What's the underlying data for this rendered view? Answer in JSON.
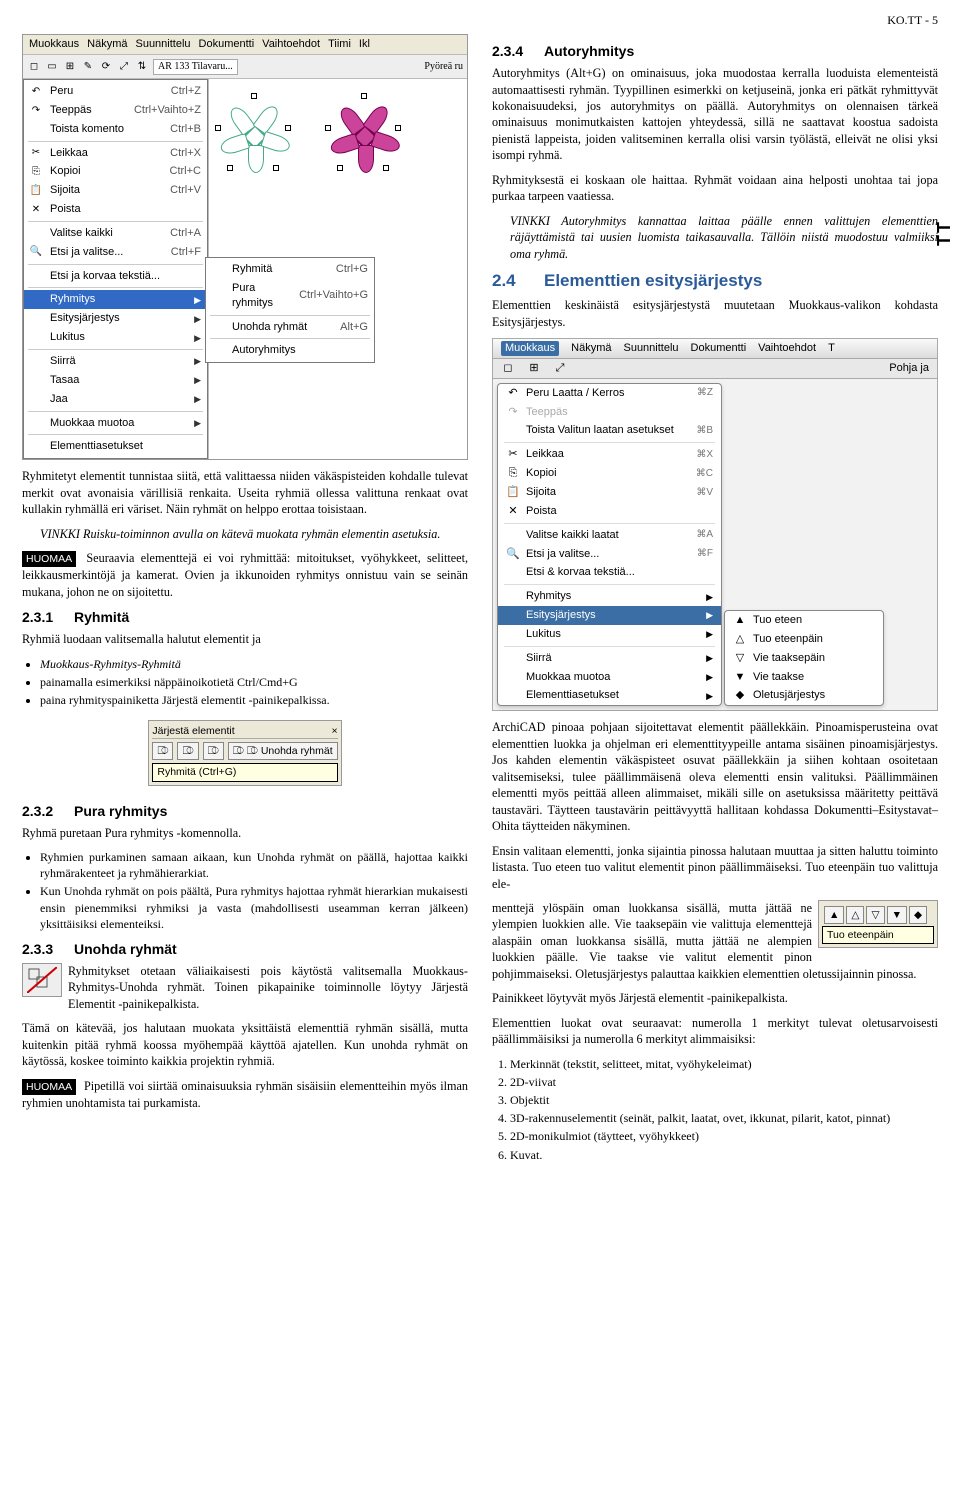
{
  "header": {
    "page_code": "KO.TT - 5"
  },
  "side_tab": "TT",
  "fig1": {
    "menubar": [
      "Muokkaus",
      "Näkymä",
      "Suunnittelu",
      "Dokumentti",
      "Vaihtoehdot",
      "Tiimi",
      "Ikl"
    ],
    "toolbar_label": "AR 133 Tilavaru...",
    "toolbar_right": "Pyöreä ru",
    "items": [
      {
        "icon": "↶",
        "label": "Peru",
        "accel": "Ctrl+Z"
      },
      {
        "icon": "↷",
        "label": "Teeppäs",
        "accel": "Ctrl+Vaihto+Z"
      },
      {
        "icon": "",
        "label": "Toista komento",
        "accel": "Ctrl+B"
      },
      {
        "sep": true
      },
      {
        "icon": "✂",
        "label": "Leikkaa",
        "accel": "Ctrl+X"
      },
      {
        "icon": "⎘",
        "label": "Kopioi",
        "accel": "Ctrl+C"
      },
      {
        "icon": "📋",
        "label": "Sijoita",
        "accel": "Ctrl+V"
      },
      {
        "icon": "✕",
        "label": "Poista",
        "accel": ""
      },
      {
        "sep": true
      },
      {
        "icon": "",
        "label": "Valitse kaikki",
        "accel": "Ctrl+A"
      },
      {
        "icon": "🔍",
        "label": "Etsi ja valitse...",
        "accel": "Ctrl+F"
      },
      {
        "sep": true
      },
      {
        "icon": "",
        "label": "Etsi ja korvaa tekstiä...",
        "accel": ""
      },
      {
        "sep": true
      },
      {
        "icon": "",
        "label": "Ryhmitys",
        "accel": "",
        "arrow": true,
        "highlight": true
      },
      {
        "icon": "",
        "label": "Esitysjärjestys",
        "accel": "",
        "arrow": true
      },
      {
        "icon": "",
        "label": "Lukitus",
        "accel": "",
        "arrow": true
      },
      {
        "sep": true
      },
      {
        "icon": "",
        "label": "Siirrä",
        "accel": "",
        "arrow": true
      },
      {
        "icon": "",
        "label": "Tasaa",
        "accel": "",
        "arrow": true
      },
      {
        "icon": "",
        "label": "Jaa",
        "accel": "",
        "arrow": true
      },
      {
        "sep": true
      },
      {
        "icon": "",
        "label": "Muokkaa muotoa",
        "accel": "",
        "arrow": true
      },
      {
        "sep": true
      },
      {
        "icon": "",
        "label": "Elementtiasetukset",
        "accel": ""
      }
    ],
    "submenu": [
      {
        "icon": "",
        "label": "Ryhmitä",
        "accel": "Ctrl+G"
      },
      {
        "icon": "",
        "label": "Pura ryhmitys",
        "accel": "Ctrl+Vaihto+G"
      },
      {
        "sep": true
      },
      {
        "icon": "",
        "label": "Unohda ryhmät",
        "accel": "Alt+G"
      },
      {
        "sep": true
      },
      {
        "icon": "",
        "label": "Autoryhmitys",
        "accel": ""
      }
    ]
  },
  "left": {
    "para1": "Ryhmitetyt elementit tunnistaa siitä, että valittaessa niiden väkäspisteiden kohdalle tulevat merkit ovat avonaisia värillisiä renkaita. Useita ryhmiä ollessa valittuna renkaat ovat kullakin ryhmällä eri väriset. Näin ryhmät on helppo erottaa toisistaan.",
    "tip1": "VINKKI Ruisku-toiminnon avulla on kätevä muokata ryhmän elementin asetuksia.",
    "huomaa1": "Seuraavia elementtejä ei voi ryhmittää: mitoitukset, vyöhykkeet, selitteet, leikkausmerkintöjä ja kamerat. Ovien ja ikkunoiden ryhmitys onnistuu vain se seinän mukana, johon ne on sijoitettu.",
    "s231_title": "Ryhmitä",
    "s231_num": "2.3.1",
    "s231_body": "Ryhmiä luodaan valitsemalla halutut elementit ja",
    "s231_list": [
      "Muokkaus-Ryhmitys-Ryhmitä",
      "painamalla esimerkiksi näppäinoikotietä Ctrl/Cmd+G",
      "paina ryhmityspainiketta Järjestä elementit -painikepalkissa."
    ],
    "fig_small": {
      "title": "Järjestä elementit",
      "btns": [
        "⎄",
        "⎄",
        "⎄",
        "⎄ Unohda ryhmät"
      ],
      "tooltip": "Ryhmitä (Ctrl+G)"
    },
    "s232_title": "Pura ryhmitys",
    "s232_num": "2.3.2",
    "s232_body": "Ryhmä puretaan Pura ryhmitys -komennolla.",
    "s232_list": [
      "Ryhmien purkaminen samaan aikaan, kun Unohda ryhmät on päällä, hajottaa kaikki ryhmärakenteet ja ryhmähierarkiat.",
      "Kun Unohda ryhmät on pois päältä, Pura ryhmitys hajottaa ryhmät hierarkian mukaisesti ensin pienemmiksi ryhmiksi ja vasta (mahdollisesti useamman kerran jälkeen) yksittäisiksi elementeiksi."
    ],
    "s233_title": "Unohda ryhmät",
    "s233_num": "2.3.3",
    "s233_body1": "Ryhmitykset otetaan väliaikaisesti pois käytöstä valitsemalla Muokkaus-Ryhmitys-Unohda ryhmät. Toinen pikapainike toiminnolle löytyy Järjestä Elementit -painikepalkista.",
    "s233_body2": "Tämä on kätevää, jos halutaan muokata yksittäistä elementtiä ryhmän sisällä, mutta kuitenkin pitää ryhmä koossa myöhempää käyttöä ajatellen. Kun unohda ryhmät on käytössä, koskee toiminto kaikkia projektin ryhmiä.",
    "huomaa2": "Pipetillä voi siirtää ominaisuuksia ryhmän sisäisiin elementteihin myös ilman ryhmien unohtamista tai purkamista."
  },
  "right": {
    "s234_title": "Autoryhmitys",
    "s234_num": "2.3.4",
    "s234_body": "Autoryhmitys (Alt+G) on ominaisuus, joka muodostaa kerralla luoduista elementeistä automaattisesti ryhmän. Tyypillinen esimerkki on ketjuseinä, jonka eri pätkät ryhmittyvät kokonaisuudeksi, jos autoryhmitys on päällä. Autoryhmitys on olennaisen tärkeä ominaisuus monimutkaisten kattojen yhteydessä, sillä ne saattavat koostua sadoista pienistä lappeista, joiden valitseminen kerralla olisi varsin työlästä, elleivät ne olisi yksi isompi ryhmä.",
    "s234_body2": "Ryhmityksestä ei koskaan ole haittaa. Ryhmät voidaan aina helposti unohtaa tai jopa purkaa tarpeen vaatiessa.",
    "tip2": "VINKKI Autoryhmitys kannattaa laittaa päälle ennen valittujen elementtien räjäyttämistä tai uusien luomista taikasauvalla. Tällöin niistä muodostuu valmiiksi oma ryhmä.",
    "s24_title": "Elementtien esitysjärjestys",
    "s24_num": "2.4",
    "s24_body": "Elementtien keskinäistä esitysjärjestystä muutetaan Muokkaus-valikon kohdasta Esitysjärjestys.",
    "fig2": {
      "menubar": [
        "Muokkaus",
        "Näkymä",
        "Suunnittelu",
        "Dokumentti",
        "Vaihtoehdot",
        "T"
      ],
      "toolbar_right": "Pohja ja",
      "items": [
        {
          "icon": "↶",
          "label": "Peru Laatta / Kerros",
          "accel": "⌘Z"
        },
        {
          "icon": "↷",
          "label": "Teeppäs",
          "accel": "",
          "dim": true
        },
        {
          "icon": "",
          "label": "Toista Valitun laatan asetukset",
          "accel": "⌘B"
        },
        {
          "sep": true
        },
        {
          "icon": "✂",
          "label": "Leikkaa",
          "accel": "⌘X"
        },
        {
          "icon": "⎘",
          "label": "Kopioi",
          "accel": "⌘C"
        },
        {
          "icon": "📋",
          "label": "Sijoita",
          "accel": "⌘V"
        },
        {
          "icon": "✕",
          "label": "Poista",
          "accel": ""
        },
        {
          "sep": true
        },
        {
          "icon": "",
          "label": "Valitse kaikki laatat",
          "accel": "⌘A"
        },
        {
          "icon": "🔍",
          "label": "Etsi ja valitse...",
          "accel": "⌘F"
        },
        {
          "icon": "",
          "label": "Etsi & korvaa tekstiä...",
          "accel": ""
        },
        {
          "sep": true
        },
        {
          "icon": "",
          "label": "Ryhmitys",
          "accel": "",
          "arrow": true
        },
        {
          "icon": "",
          "label": "Esitysjärjestys",
          "accel": "",
          "arrow": true,
          "highlight": true
        },
        {
          "icon": "",
          "label": "Lukitus",
          "accel": "",
          "arrow": true
        },
        {
          "sep": true
        },
        {
          "icon": "",
          "label": "Siirrä",
          "accel": "",
          "arrow": true
        },
        {
          "icon": "",
          "label": "Muokkaa muotoa",
          "accel": "",
          "arrow": true
        },
        {
          "icon": "",
          "label": "Elementtiasetukset",
          "accel": "",
          "arrow": true
        }
      ],
      "submenu": [
        {
          "icon": "▲",
          "label": "Tuo eteen"
        },
        {
          "icon": "△",
          "label": "Tuo eteenpäin"
        },
        {
          "icon": "▽",
          "label": "Vie taaksepäin"
        },
        {
          "icon": "▼",
          "label": "Vie taakse"
        },
        {
          "icon": "◆",
          "label": "Oletusjärjestys"
        }
      ]
    },
    "para_after_fig": "ArchiCAD pinoaa pohjaan sijoitettavat elementit päällekkäin. Pinoamisperusteina ovat elementtien luokka ja ohjelman eri elementtityypeille antama sisäinen pinoamisjärjestys. Jos kahden elementin väkäspisteet osuvat päällekkäin ja siihen kohtaan osoitetaan valitsemiseksi, tulee päällimmäisenä oleva elementti ensin valituksi. Päällimmäinen elementti myös peittää alleen alimmaiset, mikäli sille on asetuksissa määritetty peittävä taustaväri. Täytteen taustavärin peittävyyttä hallitaan kohdassa Dokumentti–Esitystavat–Ohita täytteiden näkyminen.",
    "para2": "Ensin valitaan elementti, jonka sijaintia pinossa halutaan muuttaa ja sitten haluttu toiminto listasta. Tuo eteen tuo valitut elementit pinon päällimmäiseksi. Tuo eteenpäin tuo valittuja ele-",
    "fig_order": {
      "tooltip": "Tuo eteenpäin"
    },
    "para3": "menttejä ylöspäin oman luokkansa sisällä, mutta jättää ne ylempien luokkien alle. Vie taaksepäin vie valittuja elementtejä alaspäin oman luokkansa sisällä, mutta jättää ne alempien luokkien päälle. Vie taakse vie valitut elementit pinon pohjimmaiseksi. Oletusjärjestys palauttaa kaikkien elementtien oletussijainnin pinossa.",
    "para4": "Painikkeet löytyvät myös Järjestä elementit -painikepalkista.",
    "para5": "Elementtien luokat ovat seuraavat: numerolla 1 merkityt tulevat oletusarvoisesti päällimmäisiksi ja numerolla 6 merkityt alimmaisiksi:",
    "order_list": [
      "Merkinnät (tekstit, selitteet, mitat, vyöhykeleimat)",
      "2D-viivat",
      "Objektit",
      "3D-rakennuselementit (seinät, palkit, laatat, ovet, ikkunat, pilarit, katot, pinnat)",
      "2D-monikulmiot (täytteet, vyöhykkeet)",
      "Kuvat."
    ]
  }
}
